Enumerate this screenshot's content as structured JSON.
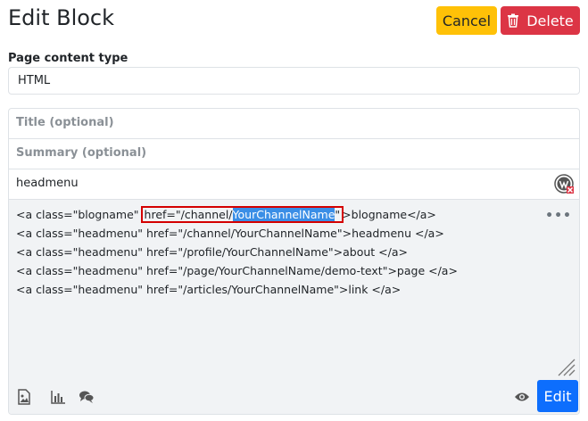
{
  "header": {
    "title": "Edit Block",
    "cancel_label": "Cancel",
    "delete_label": "Delete"
  },
  "content_type": {
    "label": "Page content type",
    "value": "HTML"
  },
  "form": {
    "title_placeholder": "Title (optional)",
    "summary_placeholder": "Summary (optional)",
    "name_value": "headmenu"
  },
  "editor": {
    "line0_pre": "<a class=\"blogname\" ",
    "line0_box_a": "href=\"/channel/",
    "line0_box_sel": "YourChannelName",
    "line0_box_b": "\"",
    "line0_post": ">blogname</a>",
    "lines": [
      "<a class=\"headmenu\" href=\"/channel/YourChannelName\">headmenu </a>",
      "<a class=\"headmenu\" href=\"/profile/YourChannelName\">about </a>",
      "<a class=\"headmenu\" href=\"/page/YourChannelName/demo-text\">page </a>",
      "<a class=\"headmenu\" href=\"/articles/YourChannelName\">link </a>"
    ],
    "more_label": "•••"
  },
  "footer": {
    "edit_label": "Edit"
  },
  "colors": {
    "cancel": "#ffc107",
    "delete": "#dc3545",
    "edit": "#0d6efd",
    "highlight_outline": "#d40000",
    "selection": "#3a8ee6"
  }
}
